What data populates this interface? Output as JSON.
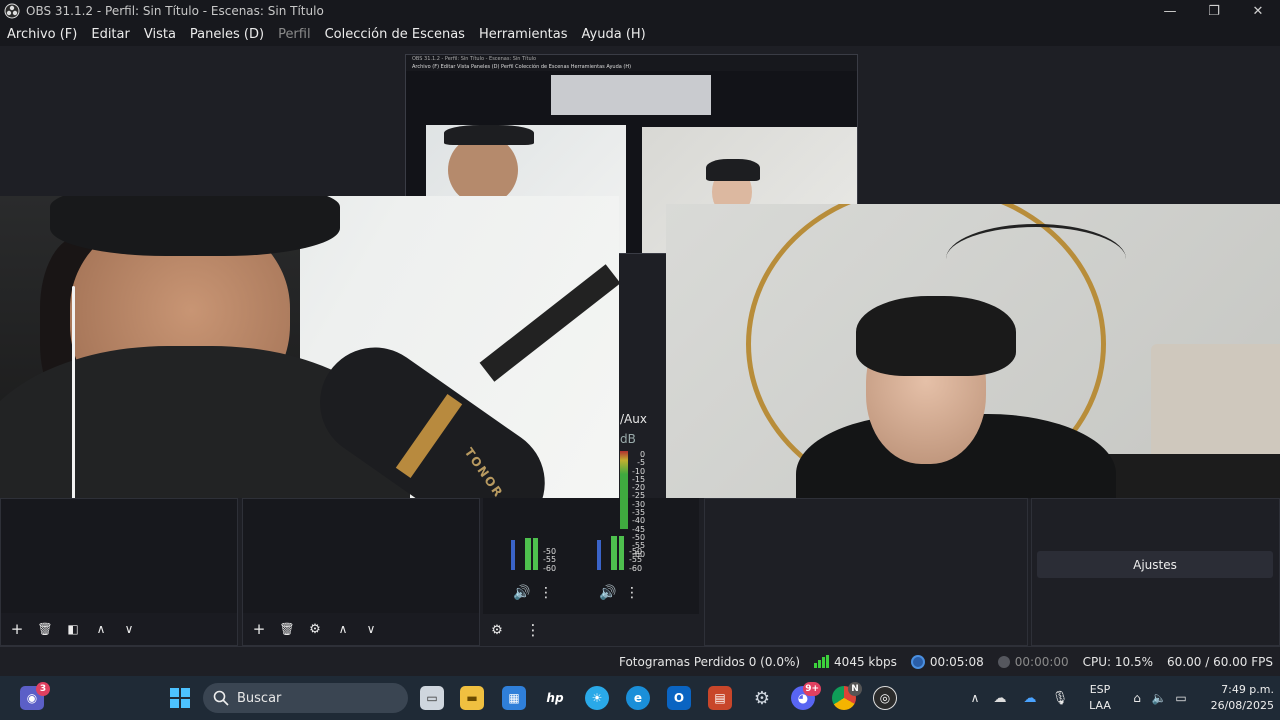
{
  "window": {
    "title": "OBS 31.1.2 - Perfil: Sin Título - Escenas: Sin Título",
    "minimize_glyph": "—",
    "maximize_glyph": "❐",
    "close_glyph": "✕"
  },
  "menu": [
    {
      "label": "Archivo (F)",
      "enabled": true
    },
    {
      "label": "Editar",
      "enabled": true
    },
    {
      "label": "Vista",
      "enabled": true
    },
    {
      "label": "Paneles (D)",
      "enabled": true
    },
    {
      "label": "Perfil",
      "enabled": false
    },
    {
      "label": "Colección de Escenas",
      "enabled": true
    },
    {
      "label": "Herramientas",
      "enabled": true
    },
    {
      "label": "Ayuda (H)",
      "enabled": true
    }
  ],
  "preview": {
    "nested_title": "OBS 31.1.2 - Perfil: Sin Título - Escenas: Sin Título",
    "nested_menu": "Archivo (F)  Editar  Vista  Paneles (D)  Perfil  Colección de Escenas  Herramientas  Ayuda (H)",
    "cam1_brand": "TONOR"
  },
  "mixer": {
    "label": "/Aux",
    "db_label": "dB",
    "scale": [
      "0",
      "-5",
      "-10",
      "-15",
      "-20",
      "-25",
      "-30",
      "-35",
      "-40",
      "-45",
      "-50",
      "-55",
      "-60"
    ],
    "channel1": {
      "visible_scale": [
        "-50",
        "-55",
        "-60"
      ],
      "level": 0.18
    },
    "channel2": {
      "visible_scale": [
        "-50",
        "-55",
        "-60"
      ],
      "level": 0.22
    },
    "speaker_glyph": "🔊",
    "more_glyph": "⋮",
    "settings_glyph": "⚙"
  },
  "controls": {
    "ajustes_label": "Ajustes"
  },
  "scenes_toolbar": {
    "add": "+",
    "remove": "🗑",
    "filter": "◧",
    "up": "∧",
    "down": "∨"
  },
  "sources_toolbar": {
    "add": "+",
    "remove": "🗑",
    "settings": "⚙",
    "up": "∧",
    "down": "∨"
  },
  "status": {
    "dropped_frames": "Fotogramas Perdidos 0 (0.0%)",
    "bitrate": "4045 kbps",
    "stream_time": "00:05:08",
    "record_time": "00:00:00",
    "cpu": "CPU: 10.5%",
    "fps": "60.00 / 60.00 FPS",
    "bitrate_color": "#3cd13c"
  },
  "taskbar": {
    "search_placeholder": "Buscar",
    "chat_badge": "3",
    "discord_badge": "9+",
    "chrome_badge": "N",
    "language_top": "ESP",
    "language_bottom": "LAA",
    "time": "7:49 p.m.",
    "date": "26/08/2025"
  }
}
